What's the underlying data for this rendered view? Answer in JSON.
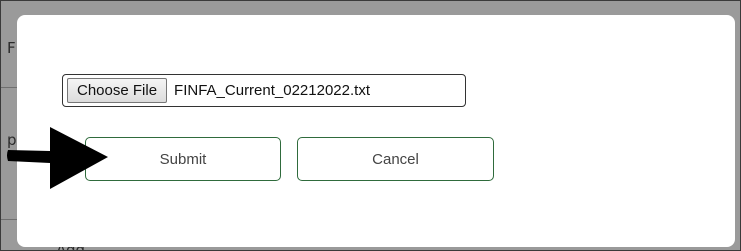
{
  "background": {
    "top_fragment": "F",
    "mid_fragment": "p",
    "bottom_fragment": "Add"
  },
  "dialog": {
    "choose_file_label": "Choose File",
    "file_name": "FINFA_Current_02212022.txt",
    "submit_label": "Submit",
    "cancel_label": "Cancel"
  },
  "annotation": {
    "icon": "arrow-right-icon",
    "color": "#000000"
  },
  "colors": {
    "button_border": "#2f6b3c",
    "overlay": "#9a9a9a"
  }
}
